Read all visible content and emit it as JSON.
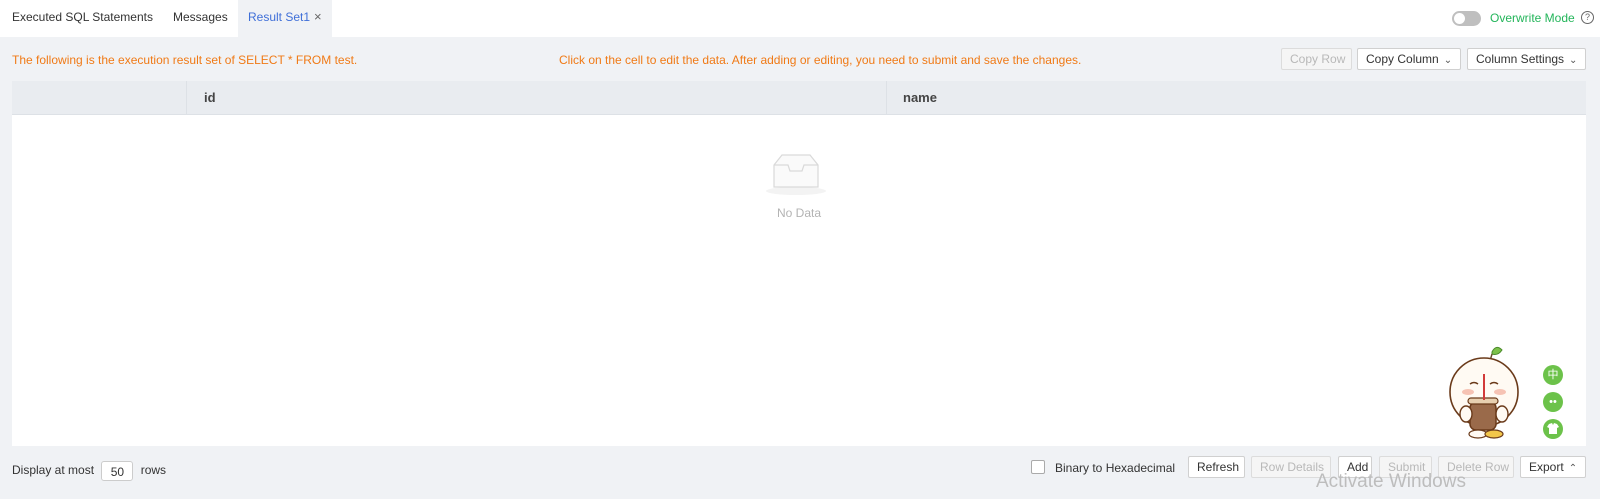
{
  "tabs": [
    {
      "label": "Executed SQL Statements"
    },
    {
      "label": "Messages"
    },
    {
      "label": "Result Set1",
      "close": "×"
    }
  ],
  "overwrite_mode": {
    "label": "Overwrite Mode",
    "enabled": false,
    "help": "?"
  },
  "info": {
    "left": "The following is the execution result set of SELECT * FROM test.",
    "middle": "Click on the cell to edit the data. After adding or editing, you need to submit and save the changes."
  },
  "top_buttons": {
    "copy_row": "Copy Row",
    "copy_column": "Copy Column",
    "column_settings": "Column Settings"
  },
  "table": {
    "columns": [
      "id",
      "name"
    ],
    "rows": [],
    "empty_text": "No Data"
  },
  "side_icons": [
    {
      "icon": "chinese-char-icon",
      "glyph": "中"
    },
    {
      "icon": "face-icon",
      "glyph": "••"
    },
    {
      "icon": "shirt-icon",
      "glyph": "👕"
    }
  ],
  "footer": {
    "display_prefix": "Display at most",
    "rows_value": "50",
    "rows_suffix": "rows",
    "binary_label": "Binary to Hexadecimal",
    "binary_checked": false,
    "buttons": {
      "refresh": "Refresh",
      "row_details": "Row Details",
      "add": "Add",
      "submit": "Submit",
      "delete_row": "Delete Row",
      "export": "Export"
    }
  },
  "watermark": "Activate Windows",
  "colors": {
    "accent_tab": "#3f6fd8",
    "info_text": "#f07a16",
    "overwrite": "#23b55a",
    "side_icon": "#6cc24a"
  }
}
